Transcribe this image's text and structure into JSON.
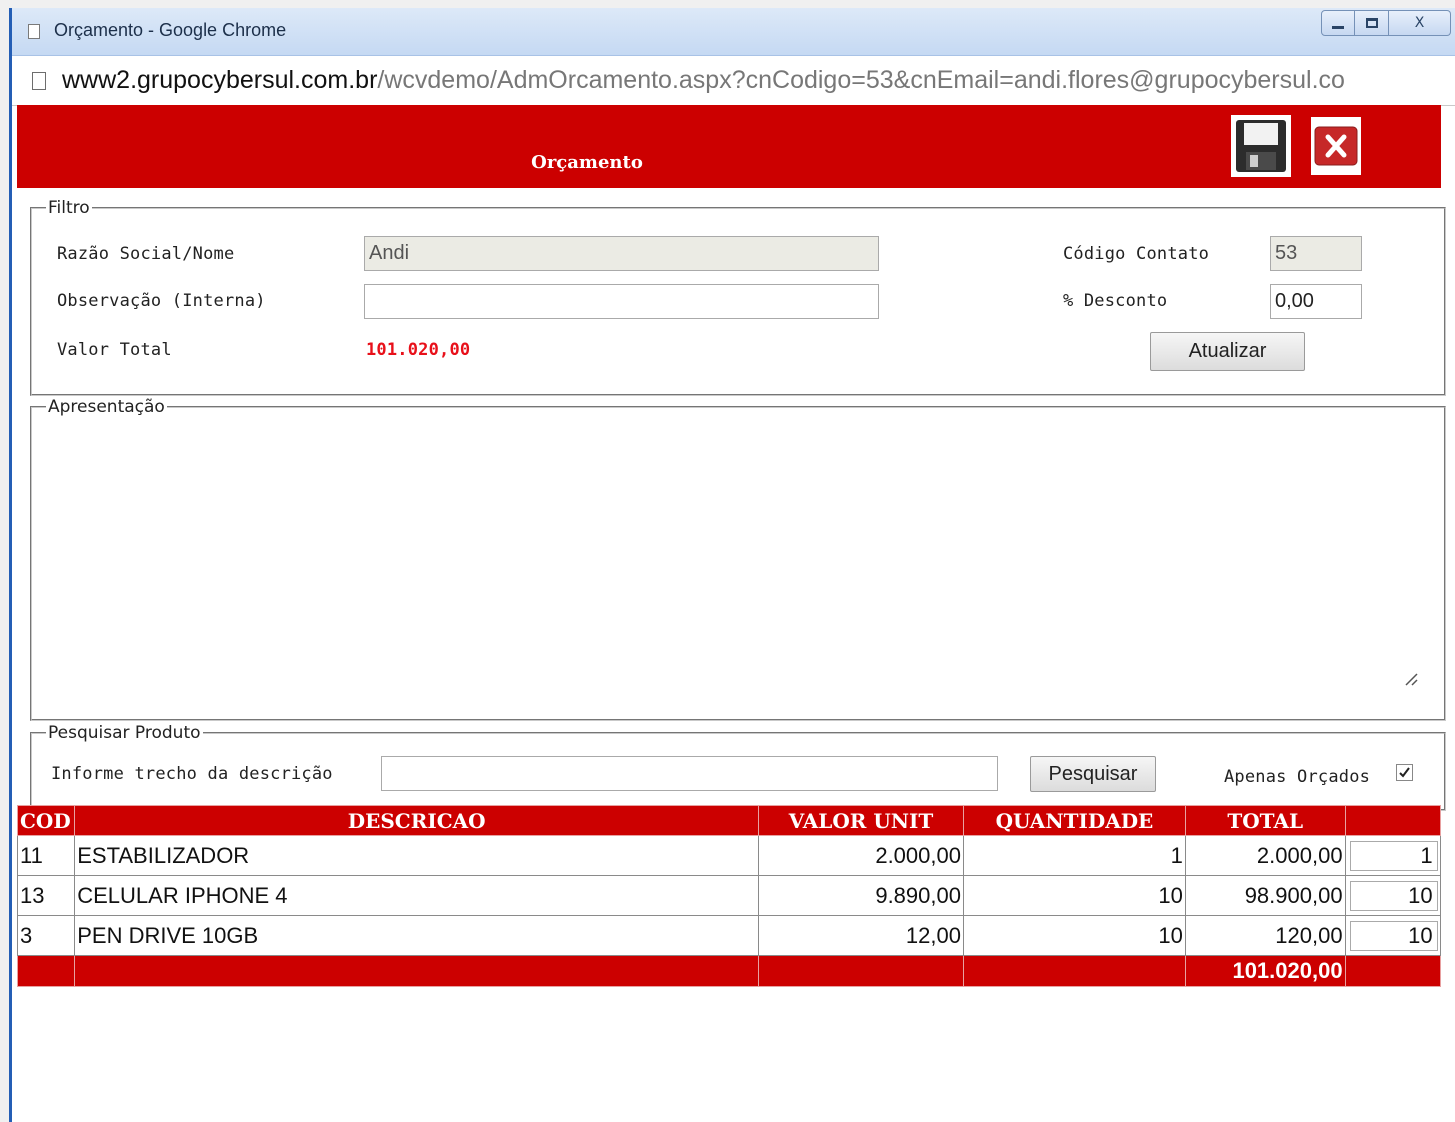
{
  "window": {
    "title": "Orçamento - Google Chrome",
    "min_icon": "minimize-icon",
    "max_icon": "maximize-icon",
    "close_icon": "close-icon",
    "close_label": "X"
  },
  "address": {
    "host": "www2.grupocybersul.com.br",
    "path": "/wcvdemo/AdmOrcamento.aspx?cnCodigo=53&cnEmail=andi.flores@grupocybersul.co"
  },
  "header": {
    "title": "Orçamento",
    "save_icon": "floppy-disk-icon",
    "close_icon": "red-x-close-icon",
    "brand_color": "#cc0000"
  },
  "filtro": {
    "legend": "Filtro",
    "razao_label": "Razão Social/Nome",
    "razao_value": "Andi",
    "obs_label": "Observação (Interna)",
    "obs_value": "",
    "valor_total_label": "Valor Total",
    "valor_total_value": "101.020,00",
    "codigo_label": "Código Contato",
    "codigo_value": "53",
    "desconto_label": "% Desconto",
    "desconto_value": "0,00",
    "atualizar_label": "Atualizar"
  },
  "apresentacao": {
    "legend": "Apresentação",
    "value": ""
  },
  "pesquisar": {
    "legend": "Pesquisar Produto",
    "trecho_label": "Informe trecho da descrição",
    "trecho_value": "",
    "pesquisar_label": "Pesquisar",
    "apenas_label": "Apenas Orçados",
    "apenas_checked": true
  },
  "table": {
    "headers": [
      "COD",
      "DESCRICAO",
      "VALOR UNIT",
      "QUANTIDADE",
      "TOTAL",
      ""
    ],
    "rows": [
      {
        "cod": "11",
        "descricao": "ESTABILIZADOR",
        "valor_unit": "2.000,00",
        "quantidade": "1",
        "total": "2.000,00",
        "qty_input": "1"
      },
      {
        "cod": "13",
        "descricao": "CELULAR IPHONE 4",
        "valor_unit": "9.890,00",
        "quantidade": "10",
        "total": "98.900,00",
        "qty_input": "10"
      },
      {
        "cod": "3",
        "descricao": "PEN DRIVE 10GB",
        "valor_unit": "12,00",
        "quantidade": "10",
        "total": "120,00",
        "qty_input": "10"
      }
    ],
    "footer_total": "101.020,00"
  }
}
